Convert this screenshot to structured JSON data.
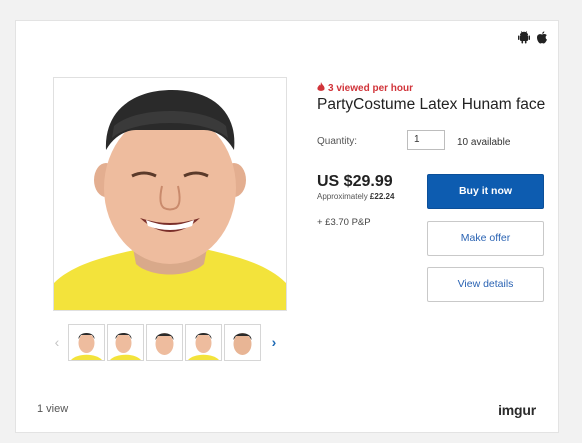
{
  "platform_icons": [
    "android-icon",
    "apple-icon"
  ],
  "listing": {
    "viewed_text": "3 viewed per hour",
    "title": "PartyCostume Latex Hunam face",
    "quantity_label": "Quantity:",
    "quantity_value": "1",
    "available_text": "10 available",
    "price": "US $29.99",
    "approx_prefix": "Approximately",
    "approx_value": "£22.24",
    "postage": "+ £3.70 P&P",
    "buttons": {
      "buy": "Buy it now",
      "offer": "Make offer",
      "details": "View details"
    }
  },
  "gallery": {
    "thumbnail_count": 5,
    "prev_icon": "chevron-left-icon",
    "next_icon": "chevron-right-icon"
  },
  "footer": {
    "views": "1 view",
    "brand": "imgur"
  },
  "colors": {
    "accent": "#0d5cb0",
    "hot": "#d1343a",
    "link": "#2a63b3"
  }
}
